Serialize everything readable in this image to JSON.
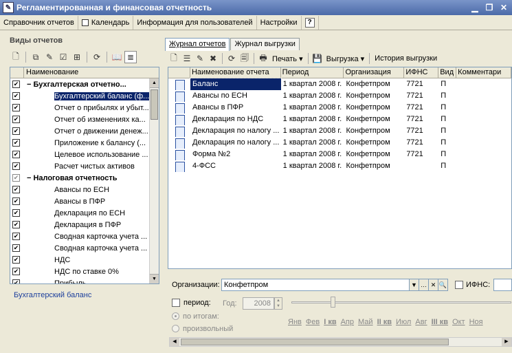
{
  "window": {
    "title": "Регламентированная и финансовая отчетность"
  },
  "menu": {
    "items": [
      "Справочник отчетов",
      "Календарь",
      "Информация для пользователей",
      "Настройки"
    ],
    "help": "?"
  },
  "left": {
    "title": "Виды отчетов",
    "header": "Наименование",
    "rows": [
      {
        "label": "Бухгалтерская отчетно...",
        "level": 0,
        "bold": true,
        "checked": true,
        "expander": "−"
      },
      {
        "label": "Бухгалтерский баланс (ф...",
        "level": 1,
        "checked": true,
        "selected": true
      },
      {
        "label": "Отчет о прибылях и убыт...",
        "level": 1,
        "checked": true
      },
      {
        "label": "Отчет об изменениях ка...",
        "level": 1,
        "checked": true
      },
      {
        "label": "Отчет о движении денеж...",
        "level": 1,
        "checked": true
      },
      {
        "label": "Приложение к балансу (...",
        "level": 1,
        "checked": true
      },
      {
        "label": "Целевое использование ...",
        "level": 1,
        "checked": true
      },
      {
        "label": "Расчет чистых активов",
        "level": 1,
        "checked": true
      },
      {
        "label": "Налоговая отчетность",
        "level": 0,
        "bold": true,
        "checked": true,
        "grey": true,
        "expander": "−"
      },
      {
        "label": "Авансы по ЕСН",
        "level": 1,
        "checked": true
      },
      {
        "label": "Авансы в ПФР",
        "level": 1,
        "checked": true
      },
      {
        "label": "Декларация по ЕСН",
        "level": 1,
        "checked": true
      },
      {
        "label": "Декларация в ПФР",
        "level": 1,
        "checked": true
      },
      {
        "label": "Сводная карточка учета ...",
        "level": 1,
        "checked": true
      },
      {
        "label": "Сводная карточка учета ...",
        "level": 1,
        "checked": true
      },
      {
        "label": "НДС",
        "level": 1,
        "checked": true
      },
      {
        "label": "НДС по ставке 0%",
        "level": 1,
        "checked": true
      },
      {
        "label": "Прибыль",
        "level": 1,
        "checked": true
      }
    ],
    "caption": "Бухгалтерский баланс"
  },
  "tabs": [
    "Журнал отчетов",
    "Журнал выгрузки"
  ],
  "toolbar": {
    "print": "Печать",
    "export": "Выгрузка",
    "history": "История выгрузки"
  },
  "journal": {
    "columns": [
      "",
      "Наименование отчета",
      "Период",
      "Организация",
      "ИФНС",
      "Вид",
      "Комментари"
    ],
    "rows": [
      [
        "Баланс",
        "1 квартал 2008 г.",
        "Конфетпром",
        "7721",
        "П",
        ""
      ],
      [
        "Авансы по ЕСН",
        "1 квартал 2008 г.",
        "Конфетпром",
        "7721",
        "П",
        ""
      ],
      [
        "Авансы в ПФР",
        "1 квартал 2008 г.",
        "Конфетпром",
        "7721",
        "П",
        ""
      ],
      [
        "Декларация по НДС",
        "1 квартал 2008 г.",
        "Конфетпром",
        "7721",
        "П",
        ""
      ],
      [
        "Декларация по налогу ...",
        "1 квартал 2008 г.",
        "Конфетпром",
        "7721",
        "П",
        ""
      ],
      [
        "Декларация по налогу ...",
        "1 квартал 2008 г.",
        "Конфетпром",
        "7721",
        "П",
        ""
      ],
      [
        "Форма №2",
        "1 квартал 2008 г.",
        "Конфетпром",
        "7721",
        "П",
        ""
      ],
      [
        "4-ФСС",
        "1 квартал 2008 г.",
        "Конфетпром",
        "",
        "П",
        ""
      ]
    ]
  },
  "filters": {
    "org_label": "Организации:",
    "org_value": "Конфетпром",
    "ifns_label": "ИФНС:",
    "period_label": "период:",
    "year_label": "Год:",
    "year_value": "2008",
    "radio1": "по итогам:",
    "radio2": "произвольный",
    "months": [
      "Янв",
      "Фев",
      "I кв",
      "Апр",
      "Май",
      "II кв",
      "Июл",
      "Авг",
      "III кв",
      "Окт",
      "Ноя"
    ]
  }
}
